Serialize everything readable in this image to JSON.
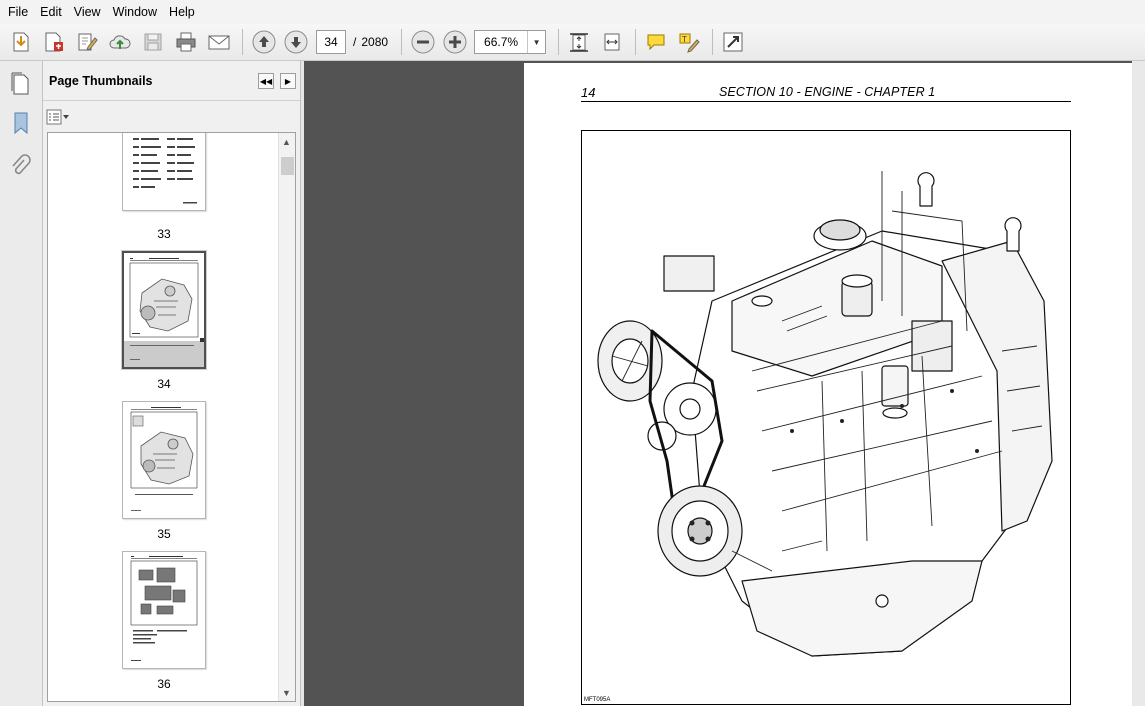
{
  "menu": [
    "File",
    "Edit",
    "View",
    "Window",
    "Help"
  ],
  "toolbar": {
    "current_page": "34",
    "page_separator": "/",
    "total_pages": "2080",
    "zoom": "66.7%"
  },
  "thumbnails": {
    "title": "Page Thumbnails",
    "items": [
      {
        "label": "33",
        "selected": false
      },
      {
        "label": "34",
        "selected": true
      },
      {
        "label": "35",
        "selected": false
      },
      {
        "label": "36",
        "selected": false
      }
    ]
  },
  "document": {
    "page_number": "14",
    "section_heading": "SECTION 10 - ENGINE - CHAPTER 1",
    "figure_code": "MFT095A"
  },
  "colors": {
    "doc_background": "#535353",
    "selection": "#cbcbcb"
  }
}
